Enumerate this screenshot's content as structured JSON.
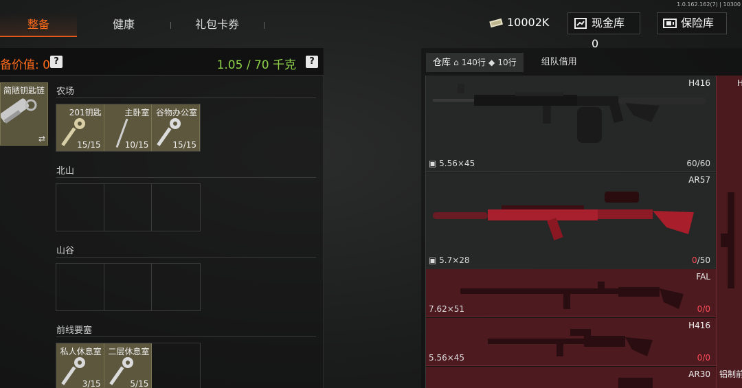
{
  "version": "1.0.162.162(7) | 10300",
  "nav": {
    "tabs": [
      {
        "label": "整备"
      },
      {
        "label": "健康"
      },
      {
        "label": "礼包卡券"
      }
    ]
  },
  "currency": {
    "cash": "10002K",
    "cashbox": "现金库 0",
    "vault": "保险库"
  },
  "left": {
    "equip_value": "备价值: 0",
    "help": "?",
    "weight": "1.05 / 70 千克",
    "keychain": {
      "label": "简陋钥匙链",
      "swap": "⇄"
    },
    "sections": [
      {
        "title": "农场",
        "slots": [
          {
            "name": "201钥匙",
            "count": "15/15"
          },
          {
            "name": "主卧室",
            "count": "10/15"
          },
          {
            "name": "谷物办公室",
            "count": "15/15"
          }
        ]
      },
      {
        "title": "北山",
        "slots": []
      },
      {
        "title": "山谷",
        "slots": []
      },
      {
        "title": "前线要塞",
        "slots": [
          {
            "name": "私人休息室",
            "count": "3/15"
          },
          {
            "name": "二层休息室",
            "count": "5/15"
          }
        ]
      }
    ]
  },
  "right": {
    "tabs": {
      "stash": "仓库",
      "rows": "140行",
      "tag_rows": "10行",
      "squad": "组队借用"
    },
    "items": [
      {
        "name": "H416",
        "caliber": "5.56×45",
        "ammo_cur": "60",
        "ammo_max": "/60"
      },
      {
        "name": "AR57",
        "caliber": "5.7×28",
        "ammo_cur": "0",
        "ammo_max": "/50"
      },
      {
        "name": "FAL",
        "caliber": "7.62×51",
        "ammo_cur": "0",
        "ammo_max": "/0"
      },
      {
        "name": "H416",
        "caliber": "5.56×45",
        "ammo_cur": "0",
        "ammo_max": "/0"
      },
      {
        "name": "AR30",
        "caliber": "",
        "ammo_cur": "",
        "ammo_max": ""
      }
    ],
    "side": {
      "top": "H",
      "bottom": "铝制前"
    }
  },
  "colors": {
    "accent": "#ff6a1a",
    "weight": "#8fd24a",
    "red_slot": "#4d1a1f",
    "key_slot": "#5d573e"
  }
}
